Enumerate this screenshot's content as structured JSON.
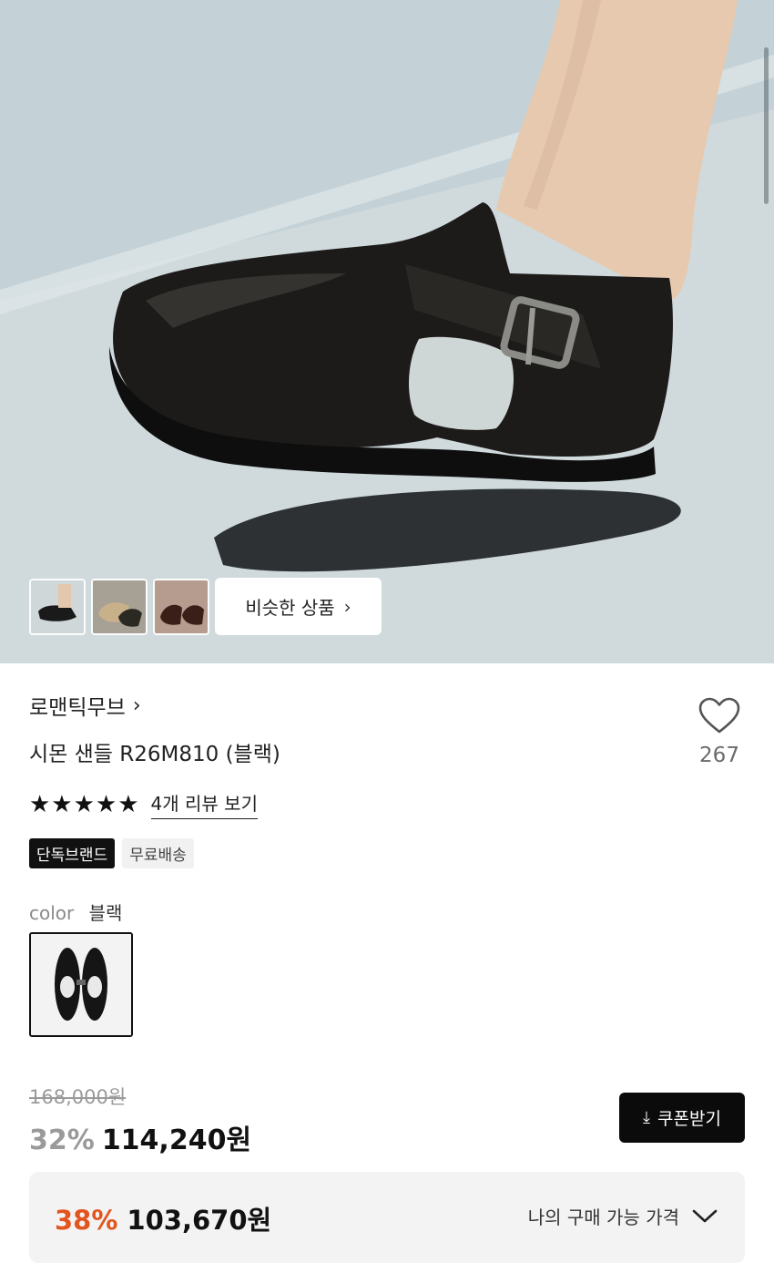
{
  "hero": {
    "image_alt": "product photo - black leather sandal",
    "thumbnails": [
      {
        "name": "thumb-black-sandal"
      },
      {
        "name": "thumb-beige-sandal"
      },
      {
        "name": "thumb-brown-sandal"
      }
    ],
    "similar_label": "비슷한 상품",
    "similar_icon": "chevron-right-icon"
  },
  "product": {
    "brand": "로맨틱무브",
    "title": "시몬 샌들 R26M810 (블랙)",
    "wish_count": "267",
    "stars": "★★★★★",
    "review_link": "4개 리뷰 보기",
    "badges": [
      "단독브랜드",
      "무료배송"
    ],
    "color_label": "color",
    "color_value": "블랙",
    "original_price": "168,000원",
    "discount_rate": "32%",
    "sale_price": "114,240원",
    "coupon_label": "쿠폰받기",
    "my_discount_rate": "38%",
    "my_price": "103,670원",
    "my_price_label": "나의 구매 가능 가격"
  },
  "colors": {
    "accent": "#e2551f",
    "dark": "#0b0b0b"
  }
}
